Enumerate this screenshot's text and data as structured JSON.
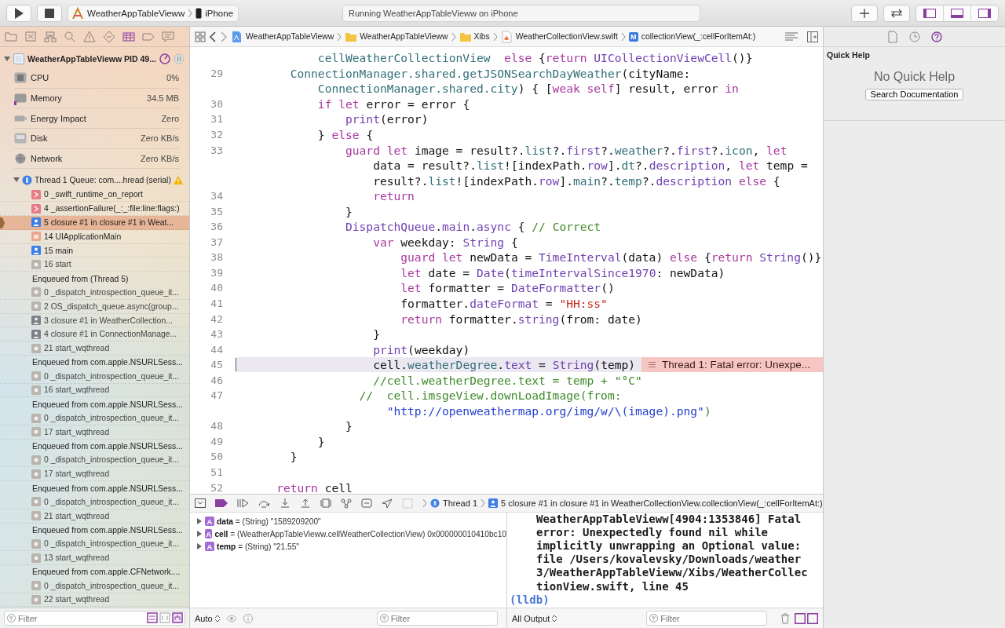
{
  "toolbar": {
    "scheme": "WeatherAppTableVieww",
    "device": "iPhone",
    "activity": "Running WeatherAppTableVieww on iPhone",
    "panels": [
      {
        "kind": "navigator",
        "on": true
      },
      {
        "kind": "debug",
        "on": true
      },
      {
        "kind": "inspector",
        "on": true
      }
    ]
  },
  "navigator": {
    "process": {
      "title": "WeatherAppTableVieww PID 49...",
      "expanded": true
    },
    "gauges": [
      {
        "kind": "cpu",
        "label": "CPU",
        "value": "0%"
      },
      {
        "kind": "memory",
        "label": "Memory",
        "value": "34.5 MB",
        "level": 0.02
      },
      {
        "kind": "energy",
        "label": "Energy Impact",
        "value": "Zero"
      },
      {
        "kind": "disk",
        "label": "Disk",
        "value": "Zero KB/s"
      },
      {
        "kind": "network",
        "label": "Network",
        "value": "Zero KB/s"
      }
    ],
    "thread": {
      "title": "Thread 1 Queue: com....hread (serial)",
      "expanded": true
    },
    "frames": [
      {
        "kind": "error",
        "label": "0 _swift_runtime_on_report",
        "selected": false
      },
      {
        "kind": "error",
        "label": "4 _assertionFailure(_:_:file:line:flags:)",
        "selected": false
      },
      {
        "kind": "user",
        "label": "5 closure #1 in closure #1 in Weat...",
        "selected": true
      },
      {
        "kind": "app",
        "label": "14 UIApplicationMain",
        "selected": false
      },
      {
        "kind": "user",
        "label": "15 main",
        "selected": false
      },
      {
        "kind": "system",
        "label": "16 start",
        "selected": false
      },
      {
        "kind": "enqueued",
        "label": "Enqueued from  (Thread 5)",
        "selected": false
      },
      {
        "kind": "system",
        "label": "0 _dispatch_introspection_queue_it...",
        "selected": false
      },
      {
        "kind": "system",
        "label": "2 OS_dispatch_queue.async(group...",
        "selected": false
      },
      {
        "kind": "user-dim",
        "label": "3 closure #1 in WeatherCollection...",
        "selected": false
      },
      {
        "kind": "user-dim",
        "label": "4 closure #1 in ConnectionManage...",
        "selected": false
      },
      {
        "kind": "system",
        "label": "21 start_wqthread",
        "selected": false
      },
      {
        "kind": "enqueued",
        "label": "Enqueued from com.apple.NSURLSess...",
        "selected": false
      },
      {
        "kind": "system",
        "label": "0 _dispatch_introspection_queue_it...",
        "selected": false
      },
      {
        "kind": "system",
        "label": "16 start_wqthread",
        "selected": false
      },
      {
        "kind": "enqueued",
        "label": "Enqueued from com.apple.NSURLSess...",
        "selected": false
      },
      {
        "kind": "system",
        "label": "0 _dispatch_introspection_queue_it...",
        "selected": false
      },
      {
        "kind": "system",
        "label": "17 start_wqthread",
        "selected": false
      },
      {
        "kind": "enqueued",
        "label": "Enqueued from com.apple.NSURLSess...",
        "selected": false
      },
      {
        "kind": "system",
        "label": "0 _dispatch_introspection_queue_it...",
        "selected": false
      },
      {
        "kind": "system",
        "label": "17 start_wqthread",
        "selected": false
      },
      {
        "kind": "enqueued",
        "label": "Enqueued from com.apple.NSURLSess...",
        "selected": false
      },
      {
        "kind": "system",
        "label": "0 _dispatch_introspection_queue_it...",
        "selected": false
      },
      {
        "kind": "system",
        "label": "21 start_wqthread",
        "selected": false
      },
      {
        "kind": "enqueued",
        "label": "Enqueued from com.apple.NSURLSess...",
        "selected": false
      },
      {
        "kind": "system",
        "label": "0 _dispatch_introspection_queue_it...",
        "selected": false
      },
      {
        "kind": "system",
        "label": "13 start_wqthread",
        "selected": false
      },
      {
        "kind": "enqueued",
        "label": "Enqueued from com.apple.CFNetwork....",
        "selected": false
      },
      {
        "kind": "system",
        "label": "0 _dispatch_introspection_queue_it...",
        "selected": false
      },
      {
        "kind": "system",
        "label": "22 start_wqthread",
        "selected": false
      }
    ],
    "filter": {
      "placeholder": "Filter"
    }
  },
  "jump_bar": {
    "path": [
      {
        "kind": "project",
        "label": "WeatherAppTableVieww"
      },
      {
        "kind": "folder",
        "label": "WeatherAppTableVieww"
      },
      {
        "kind": "folder",
        "label": "Xibs"
      },
      {
        "kind": "swift",
        "label": "WeatherCollectionView.swift"
      },
      {
        "kind": "method",
        "badge": "M",
        "label": "collectionView(_:cellForItemAt:)"
      }
    ]
  },
  "editor": {
    "lines": [
      {
        "highlighted": false,
        "segments": [
          {
            "kind": "project",
            "text": "          cellWeatherCollectionView"
          },
          {
            "kind": "keyword",
            "text": "  else"
          },
          {
            "kind": "plain",
            "text": " {"
          },
          {
            "kind": "keyword",
            "text": "return"
          },
          {
            "kind": "type",
            "text": " UICollectionViewCell"
          },
          {
            "kind": "plain",
            "text": "()}"
          }
        ]
      },
      {
        "number": "29",
        "highlighted": false,
        "segments": [
          {
            "kind": "project",
            "text": "      ConnectionManager.shared.getJSONSearchDayWeather"
          },
          {
            "kind": "plain",
            "text": "(cityName:"
          }
        ]
      },
      {
        "highlighted": false,
        "segments": [
          {
            "kind": "project",
            "text": "          ConnectionManager.shared.city"
          },
          {
            "kind": "plain",
            "text": ") { ["
          },
          {
            "kind": "keyword",
            "text": "weak self"
          },
          {
            "kind": "plain",
            "text": "] result, error "
          },
          {
            "kind": "keyword",
            "text": "in"
          }
        ]
      },
      {
        "number": "30",
        "highlighted": false,
        "segments": [
          {
            "kind": "keyword",
            "text": "          if let"
          },
          {
            "kind": "plain",
            "text": " error = error {"
          }
        ]
      },
      {
        "number": "31",
        "highlighted": false,
        "segments": [
          {
            "kind": "type",
            "text": "              print"
          },
          {
            "kind": "plain",
            "text": "(error)"
          }
        ]
      },
      {
        "number": "32",
        "highlighted": false,
        "segments": [
          {
            "kind": "plain",
            "text": "          } "
          },
          {
            "kind": "keyword",
            "text": "else"
          },
          {
            "kind": "plain",
            "text": " {"
          }
        ]
      },
      {
        "number": "33",
        "highlighted": false,
        "segments": [
          {
            "kind": "keyword",
            "text": "              guard let"
          },
          {
            "kind": "plain",
            "text": " image = result?."
          },
          {
            "kind": "project",
            "text": "list"
          },
          {
            "kind": "plain",
            "text": "?."
          },
          {
            "kind": "type",
            "text": "first"
          },
          {
            "kind": "plain",
            "text": "?."
          },
          {
            "kind": "project",
            "text": "weather"
          },
          {
            "kind": "plain",
            "text": "?."
          },
          {
            "kind": "type",
            "text": "first"
          },
          {
            "kind": "plain",
            "text": "?."
          },
          {
            "kind": "project",
            "text": "icon"
          },
          {
            "kind": "plain",
            "text": ", "
          },
          {
            "kind": "keyword",
            "text": "let"
          }
        ]
      },
      {
        "highlighted": false,
        "segments": [
          {
            "kind": "plain",
            "text": "                  data = result?."
          },
          {
            "kind": "project",
            "text": "list"
          },
          {
            "kind": "plain",
            "text": "![indexPath."
          },
          {
            "kind": "type",
            "text": "row"
          },
          {
            "kind": "plain",
            "text": "]."
          },
          {
            "kind": "project",
            "text": "dt"
          },
          {
            "kind": "plain",
            "text": "?."
          },
          {
            "kind": "type",
            "text": "description"
          },
          {
            "kind": "plain",
            "text": ", "
          },
          {
            "kind": "keyword",
            "text": "let"
          },
          {
            "kind": "plain",
            "text": " temp ="
          }
        ]
      },
      {
        "highlighted": false,
        "segments": [
          {
            "kind": "plain",
            "text": "                  result?."
          },
          {
            "kind": "project",
            "text": "list"
          },
          {
            "kind": "plain",
            "text": "![indexPath."
          },
          {
            "kind": "type",
            "text": "row"
          },
          {
            "kind": "plain",
            "text": "]."
          },
          {
            "kind": "project",
            "text": "main"
          },
          {
            "kind": "plain",
            "text": "?."
          },
          {
            "kind": "project",
            "text": "temp"
          },
          {
            "kind": "plain",
            "text": "?."
          },
          {
            "kind": "type",
            "text": "description"
          },
          {
            "kind": "keyword",
            "text": " else"
          },
          {
            "kind": "plain",
            "text": " {"
          }
        ]
      },
      {
        "number": "34",
        "highlighted": false,
        "segments": [
          {
            "kind": "keyword",
            "text": "                  return"
          }
        ]
      },
      {
        "number": "35",
        "highlighted": false,
        "segments": [
          {
            "kind": "plain",
            "text": "              }"
          }
        ]
      },
      {
        "number": "36",
        "highlighted": false,
        "segments": [
          {
            "kind": "type",
            "text": "              DispatchQueue"
          },
          {
            "kind": "plain",
            "text": "."
          },
          {
            "kind": "type",
            "text": "main"
          },
          {
            "kind": "plain",
            "text": "."
          },
          {
            "kind": "type",
            "text": "async"
          },
          {
            "kind": "plain",
            "text": " { "
          },
          {
            "kind": "comment",
            "text": "// Correct"
          }
        ]
      },
      {
        "number": "37",
        "highlighted": false,
        "segments": [
          {
            "kind": "keyword",
            "text": "                  var"
          },
          {
            "kind": "plain",
            "text": " weekday: "
          },
          {
            "kind": "type",
            "text": "String"
          },
          {
            "kind": "plain",
            "text": " {"
          }
        ]
      },
      {
        "number": "38",
        "highlighted": false,
        "segments": [
          {
            "kind": "keyword",
            "text": "                      guard let"
          },
          {
            "kind": "plain",
            "text": " newData = "
          },
          {
            "kind": "type",
            "text": "TimeInterval"
          },
          {
            "kind": "plain",
            "text": "(data) "
          },
          {
            "kind": "keyword",
            "text": "else"
          },
          {
            "kind": "plain",
            "text": " {"
          },
          {
            "kind": "keyword",
            "text": "return"
          },
          {
            "kind": "type",
            "text": " String"
          },
          {
            "kind": "plain",
            "text": "()}"
          }
        ]
      },
      {
        "number": "39",
        "highlighted": false,
        "segments": [
          {
            "kind": "keyword",
            "text": "                      let"
          },
          {
            "kind": "plain",
            "text": " date = "
          },
          {
            "kind": "type",
            "text": "Date"
          },
          {
            "kind": "plain",
            "text": "("
          },
          {
            "kind": "type",
            "text": "timeIntervalSince1970"
          },
          {
            "kind": "plain",
            "text": ": newData)"
          }
        ]
      },
      {
        "number": "40",
        "highlighted": false,
        "segments": [
          {
            "kind": "keyword",
            "text": "                      let"
          },
          {
            "kind": "plain",
            "text": " formatter = "
          },
          {
            "kind": "type",
            "text": "DateFormatter"
          },
          {
            "kind": "plain",
            "text": "()"
          }
        ]
      },
      {
        "number": "41",
        "highlighted": false,
        "segments": [
          {
            "kind": "plain",
            "text": "                      formatter."
          },
          {
            "kind": "type",
            "text": "dateFormat"
          },
          {
            "kind": "plain",
            "text": " = "
          },
          {
            "kind": "string",
            "text": "\"HH:ss\""
          }
        ]
      },
      {
        "number": "42",
        "highlighted": false,
        "segments": [
          {
            "kind": "keyword",
            "text": "                      return"
          },
          {
            "kind": "plain",
            "text": " formatter."
          },
          {
            "kind": "type",
            "text": "string"
          },
          {
            "kind": "plain",
            "text": "(from: date)"
          }
        ]
      },
      {
        "number": "43",
        "highlighted": false,
        "segments": [
          {
            "kind": "plain",
            "text": "                  }"
          }
        ]
      },
      {
        "number": "44",
        "highlighted": false,
        "segments": [
          {
            "kind": "type",
            "text": "                  print"
          },
          {
            "kind": "plain",
            "text": "(weekday)"
          }
        ]
      },
      {
        "number": "45",
        "highlighted": true,
        "annotation": "Thread 1: Fatal error: Unexpe...",
        "segments": [
          {
            "kind": "plain",
            "text": "                  cell."
          },
          {
            "kind": "project",
            "text": "weatherDegree"
          },
          {
            "kind": "plain",
            "text": "."
          },
          {
            "kind": "type",
            "text": "text"
          },
          {
            "kind": "plain",
            "text": " = "
          },
          {
            "kind": "type",
            "text": "String"
          },
          {
            "kind": "plain",
            "text": "(temp)"
          }
        ]
      },
      {
        "number": "46",
        "highlighted": false,
        "segments": [
          {
            "kind": "comment",
            "text": "                  //cell.weatherDegree.text = temp + \"°C\""
          }
        ]
      },
      {
        "number": "47",
        "highlighted": false,
        "segments": [
          {
            "kind": "comment",
            "text": "                //  cell.imsgeView.downLoadImage(from:"
          }
        ]
      },
      {
        "highlighted": false,
        "segments": [
          {
            "kind": "link",
            "text": "                    \"http://openweathermap.org/img/w/\\(image).png\""
          },
          {
            "kind": "comment",
            "text": ")"
          }
        ]
      },
      {
        "number": "48",
        "highlighted": false,
        "segments": [
          {
            "kind": "plain",
            "text": "              }"
          }
        ]
      },
      {
        "number": "49",
        "highlighted": false,
        "segments": [
          {
            "kind": "plain",
            "text": "          }"
          }
        ]
      },
      {
        "number": "50",
        "highlighted": false,
        "segments": [
          {
            "kind": "plain",
            "text": "      }"
          }
        ]
      },
      {
        "number": "51",
        "highlighted": false
      },
      {
        "number": "52",
        "highlighted": false,
        "segments": [
          {
            "kind": "keyword",
            "text": "    return"
          },
          {
            "kind": "plain",
            "text": " cell"
          }
        ]
      }
    ]
  },
  "debug_bar": {
    "thread": "Thread 1",
    "frame": "5 closure #1 in closure #1 in WeatherCollectionView.collectionView(_:cellForItemAt:)"
  },
  "variables": [
    {
      "badge": "A",
      "expanded": false,
      "text": "**data** = (String) \"1589209200\""
    },
    {
      "badge": "A",
      "expanded": false,
      "text": "**cell** = (WeatherAppTableVieww.cellWeatherCollectionView) 0x000000010410bc10"
    },
    {
      "badge": "A",
      "expanded": false,
      "text": "**temp** = (String) \"21.55\""
    }
  ],
  "variables_bar": {
    "scope": "Auto",
    "filter": {
      "placeholder": "Filter"
    }
  },
  "console": {
    "lines": [
      "WeatherAppTableVieww[4904:1353846] Fatal",
      "error: Unexpectedly found nil while",
      "implicitly unwrapping an Optional value:",
      "file /Users/kovalevsky/Downloads/weather",
      "3/WeatherAppTableVieww/Xibs/WeatherCollec",
      "tionView.swift, line 45"
    ],
    "prompt": "(lldb)",
    "output_menu": "All Output",
    "filter": {
      "placeholder": "Filter"
    }
  },
  "inspector": {
    "tabs": [
      {
        "kind": "file",
        "selected": false
      },
      {
        "kind": "history",
        "selected": false
      },
      {
        "kind": "help",
        "selected": true
      }
    ],
    "title": "Quick Help",
    "message": "No Quick Help",
    "button": "Search Documentation"
  }
}
